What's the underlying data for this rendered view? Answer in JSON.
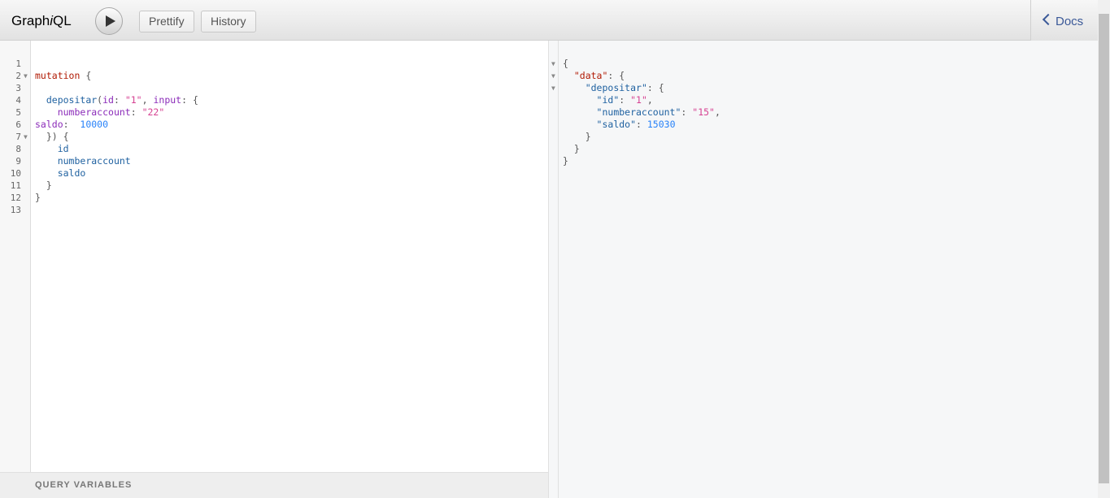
{
  "app": {
    "logo_pre": "Graph",
    "logo_i": "i",
    "logo_post": "QL"
  },
  "toolbar": {
    "prettify_label": "Prettify",
    "history_label": "History",
    "docs_label": "Docs"
  },
  "query_variables_label": "QUERY VARIABLES",
  "query": {
    "line_numbers": [
      "1",
      "2",
      "3",
      "4",
      "5",
      "6",
      "7",
      "8",
      "9",
      "10",
      "11",
      "12",
      "13"
    ],
    "mutation_kw": "mutation",
    "brace_open": "{",
    "depositar": "depositar",
    "id_arg": "id",
    "id_value": "\"1\"",
    "input_arg": "input",
    "numberaccount_field": "numberaccount",
    "numberaccount_value": "\"22\"",
    "saldo_field": "saldo",
    "saldo_value": "10000",
    "sel_id": "id",
    "sel_numberaccount": "numberaccount",
    "sel_saldo": "saldo"
  },
  "result": {
    "data_key": "\"data\"",
    "depositar_key": "\"depositar\"",
    "id_key": "\"id\"",
    "id_value": "\"1\"",
    "numberaccount_key": "\"numberaccount\"",
    "numberaccount_value": "\"15\"",
    "saldo_key": "\"saldo\"",
    "saldo_value": "15030"
  }
}
